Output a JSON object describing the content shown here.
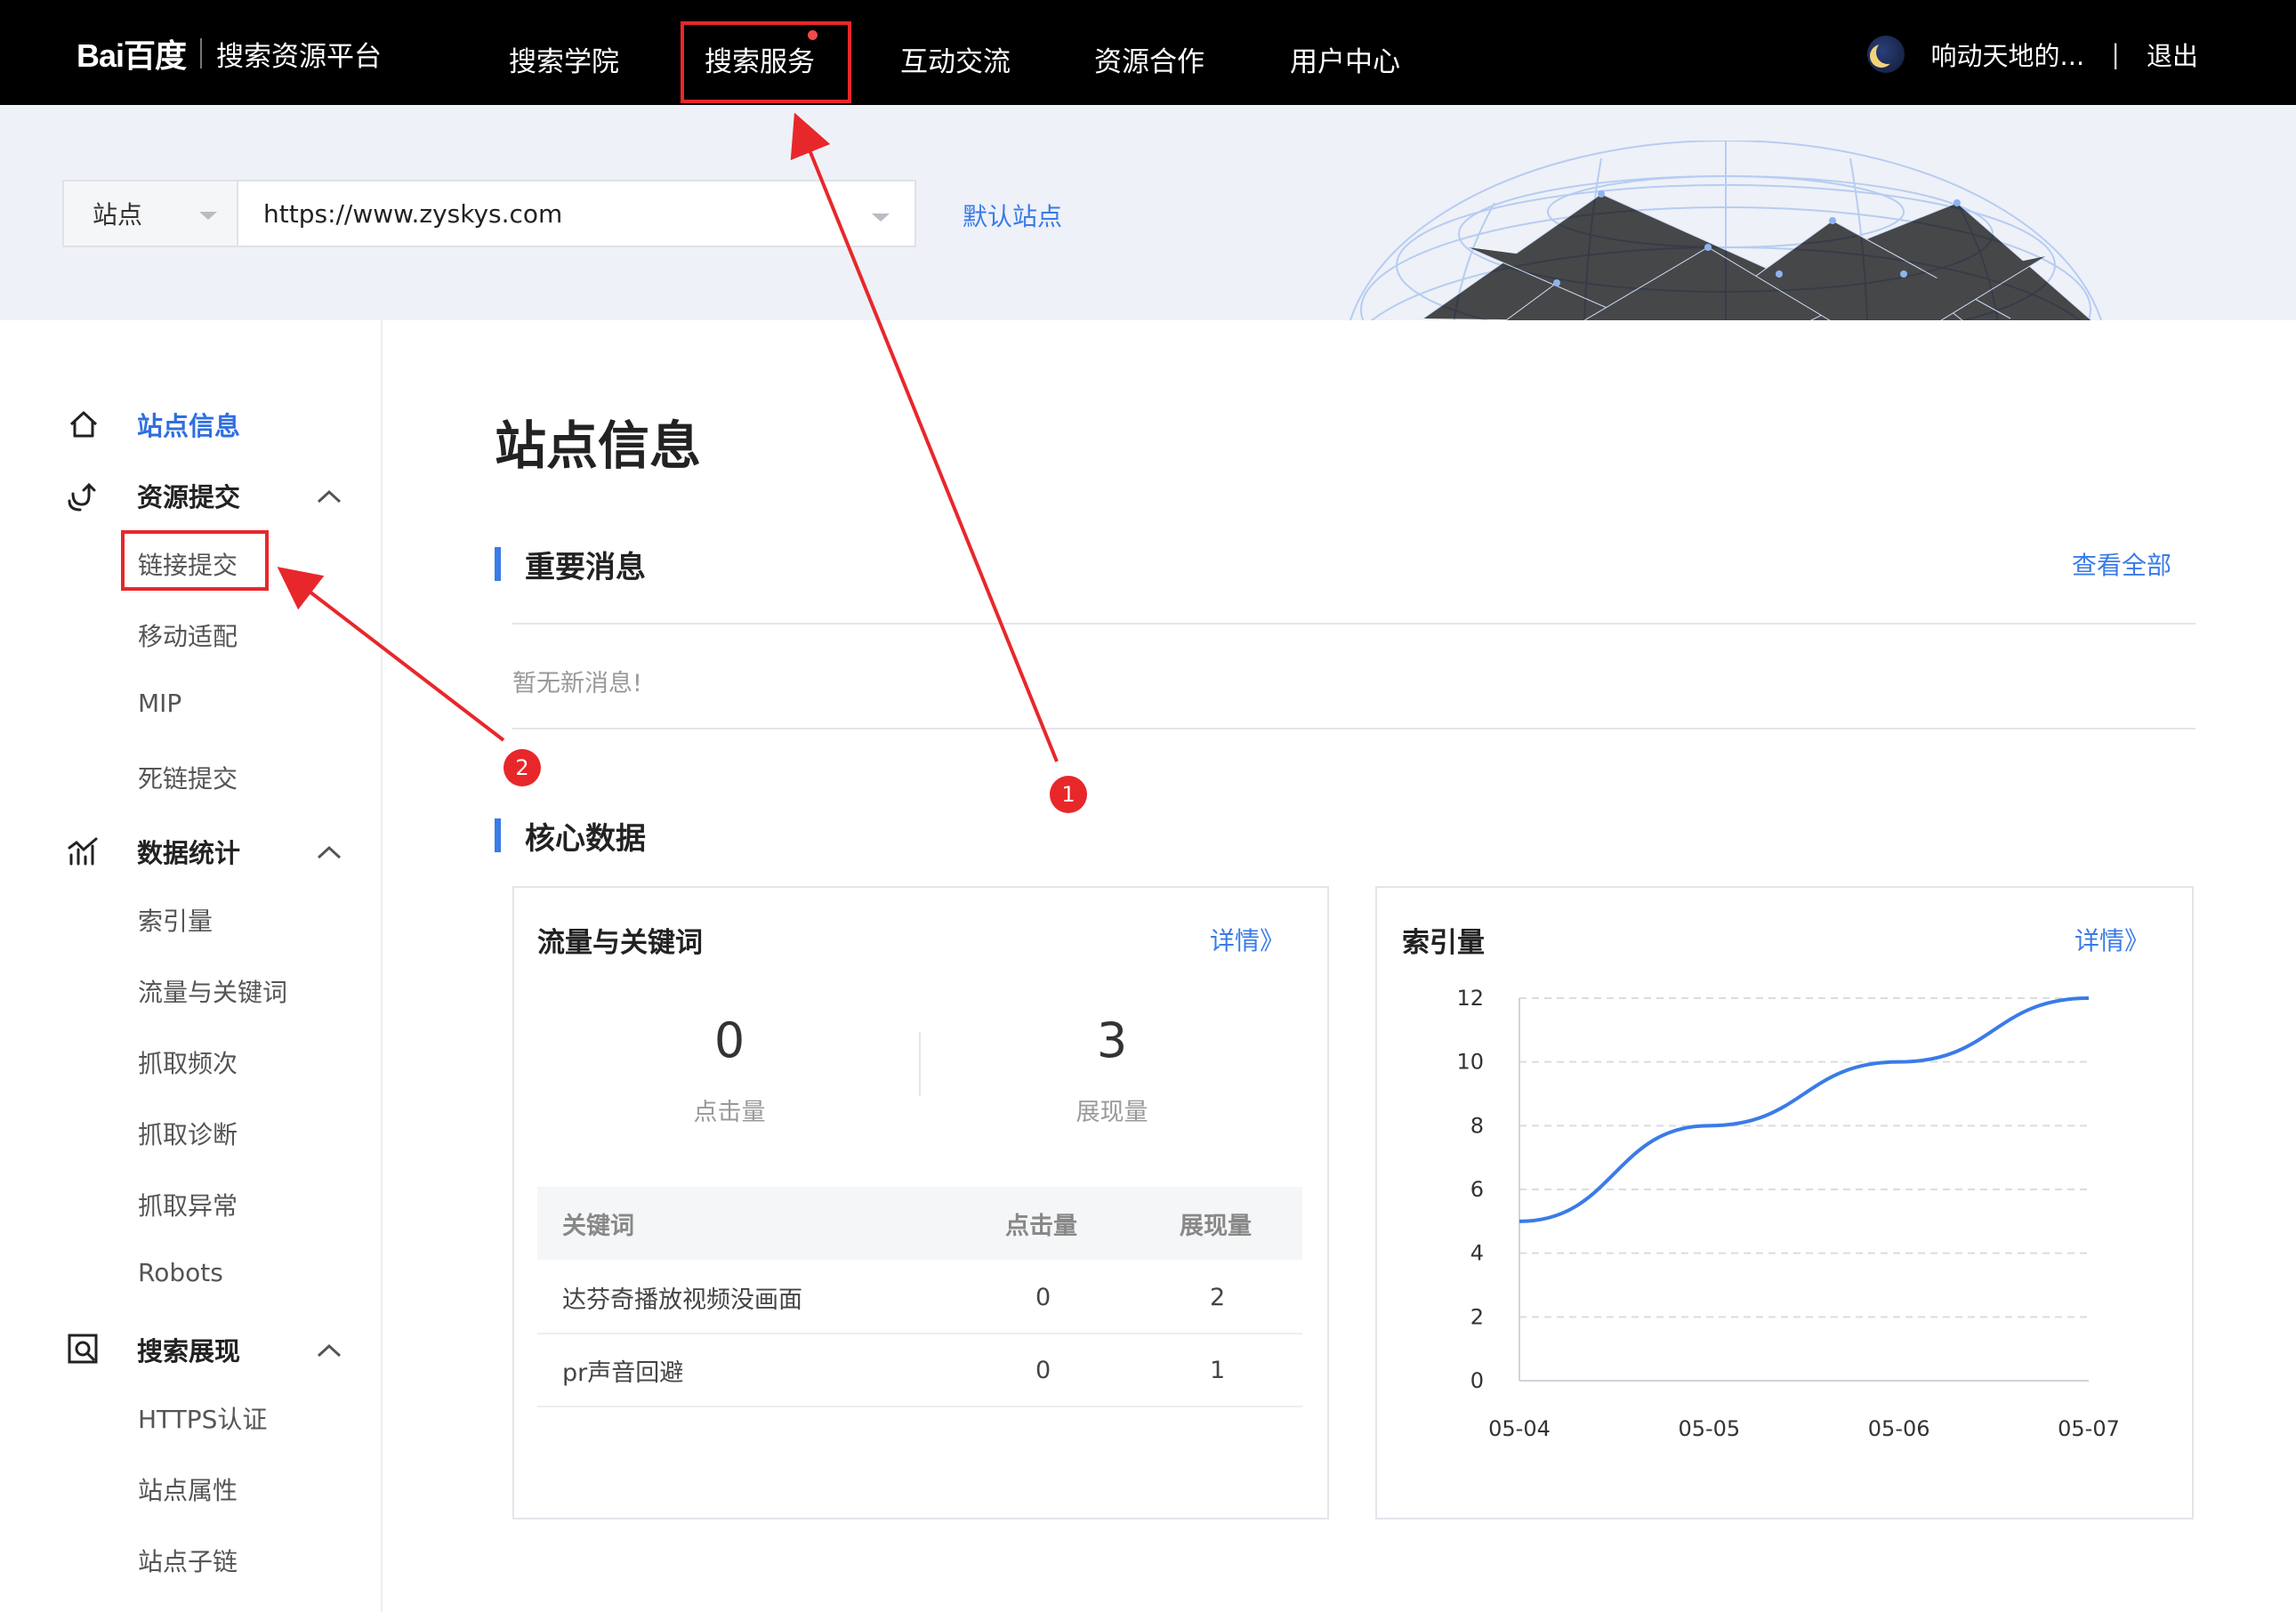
{
  "header": {
    "logo_text": "Bai百度",
    "platform_name": "搜索资源平台",
    "nav": [
      {
        "label": "搜索学院"
      },
      {
        "label": "搜索服务"
      },
      {
        "label": "互动交流"
      },
      {
        "label": "资源合作"
      },
      {
        "label": "用户中心"
      }
    ],
    "user_name": "响动天地的...",
    "divider": "|",
    "logout": "退出"
  },
  "site_bar": {
    "type_label": "站点",
    "url": "https://www.zyskys.com",
    "default_site": "默认站点"
  },
  "sidebar": {
    "site_info": "站点信息",
    "groups": [
      {
        "label": "资源提交",
        "items": [
          "链接提交",
          "移动适配",
          "MIP",
          "死链提交"
        ]
      },
      {
        "label": "数据统计",
        "items": [
          "索引量",
          "流量与关键词",
          "抓取频次",
          "抓取诊断",
          "抓取异常",
          "Robots"
        ]
      },
      {
        "label": "搜索展现",
        "items": [
          "HTTPS认证",
          "站点属性",
          "站点子链"
        ]
      }
    ]
  },
  "main": {
    "title": "站点信息",
    "important": {
      "title": "重要消息",
      "view_all": "查看全部",
      "empty": "暂无新消息!"
    },
    "core": {
      "title": "核心数据",
      "traffic": {
        "title": "流量与关键词",
        "detail": "详情》",
        "clicks": "0",
        "clicks_label": "点击量",
        "impressions": "3",
        "impressions_label": "展现量",
        "table": {
          "headers": [
            "关键词",
            "点击量",
            "展现量"
          ],
          "rows": [
            [
              "达芬奇播放视频没画面",
              "0",
              "2"
            ],
            [
              "pr声音回避",
              "0",
              "1"
            ]
          ]
        }
      },
      "index": {
        "title": "索引量",
        "detail": "详情》"
      }
    }
  },
  "annotations": {
    "badge_1": "1",
    "badge_2": "2",
    "color": "#e8272b"
  },
  "colors": {
    "accent": "#3a7be8",
    "topbar": "#000000",
    "banner": "#eef1f7"
  },
  "chart_data": {
    "type": "line",
    "title": "索引量",
    "x": [
      "05-04",
      "05-05",
      "05-06",
      "05-07"
    ],
    "series": [
      {
        "values": [
          5,
          8,
          10,
          12
        ]
      }
    ],
    "ylim": [
      0,
      12
    ],
    "yticks": [
      0,
      2,
      4,
      6,
      8,
      10,
      12
    ],
    "grid": true,
    "line_color": "#3a7be8"
  }
}
